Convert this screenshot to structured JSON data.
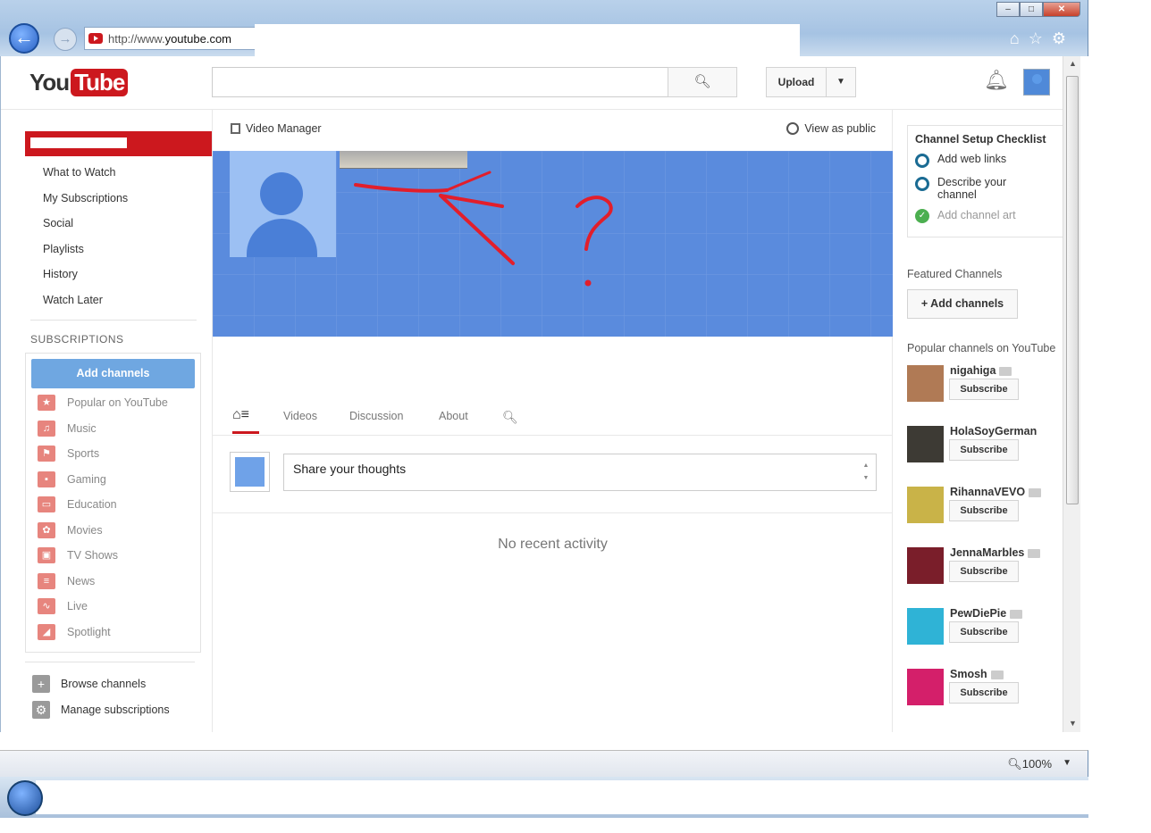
{
  "browser": {
    "url_prefix": "http://www.",
    "url_host": "youtube.com",
    "window_controls": [
      "–",
      "□",
      "✕"
    ],
    "zoom": "100%"
  },
  "masthead": {
    "logo_you": "You",
    "logo_tube": "Tube",
    "search_placeholder": "",
    "search_icon": "search-icon",
    "upload_label": "Upload"
  },
  "guide": {
    "links": [
      "What to Watch",
      "My Subscriptions",
      "Social",
      "Playlists",
      "History",
      "Watch Later"
    ],
    "subscriptions_heading": "SUBSCRIPTIONS",
    "add_channels_label": "Add channels",
    "subscriptions": [
      {
        "label": "Popular on YouTube",
        "icon": "★"
      },
      {
        "label": "Music",
        "icon": "♫"
      },
      {
        "label": "Sports",
        "icon": "⚑"
      },
      {
        "label": "Gaming",
        "icon": "▪"
      },
      {
        "label": "Education",
        "icon": "▭"
      },
      {
        "label": "Movies",
        "icon": "✿"
      },
      {
        "label": "TV Shows",
        "icon": "▣"
      },
      {
        "label": "News",
        "icon": "≡"
      },
      {
        "label": "Live",
        "icon": "∿"
      },
      {
        "label": "Spotlight",
        "icon": "◢"
      }
    ],
    "bottom": [
      {
        "label": "Browse channels",
        "icon": "+"
      },
      {
        "label": "Manage subscriptions",
        "icon": "⚙"
      }
    ]
  },
  "channel": {
    "video_manager_label": "Video Manager",
    "view_as_public_label": "View as public",
    "tabs": [
      "Videos",
      "Discussion",
      "About"
    ],
    "share_placeholder": "Share your thoughts",
    "no_activity": "No recent activity"
  },
  "right": {
    "checklist_title": "Channel Setup Checklist",
    "checklist_items": [
      {
        "label": "Add web links",
        "done": false
      },
      {
        "label": "Describe your channel",
        "done": false
      },
      {
        "label": "Add channel art",
        "done": true
      }
    ],
    "featured_heading": "Featured Channels",
    "add_channels_label": "+ Add channels",
    "popular_heading": "Popular channels on YouTube",
    "subscribe_label": "Subscribe",
    "popular_channels": [
      {
        "name": "nigahiga",
        "verified": true,
        "color": "#b07a55"
      },
      {
        "name": "HolaSoyGerman",
        "verified": false,
        "color": "#3d3a34"
      },
      {
        "name": "RihannaVEVO",
        "verified": true,
        "color": "#c9b348"
      },
      {
        "name": "JennaMarbles",
        "verified": true,
        "color": "#7a1e2a"
      },
      {
        "name": "PewDiePie",
        "verified": true,
        "color": "#2fb3d6"
      },
      {
        "name": "Smosh",
        "verified": true,
        "color": "#d41f6a"
      }
    ]
  },
  "colors": {
    "brand_red": "#cc181e",
    "banner_blue": "#5a8bdd",
    "accent_blue": "#6fa7e1"
  }
}
